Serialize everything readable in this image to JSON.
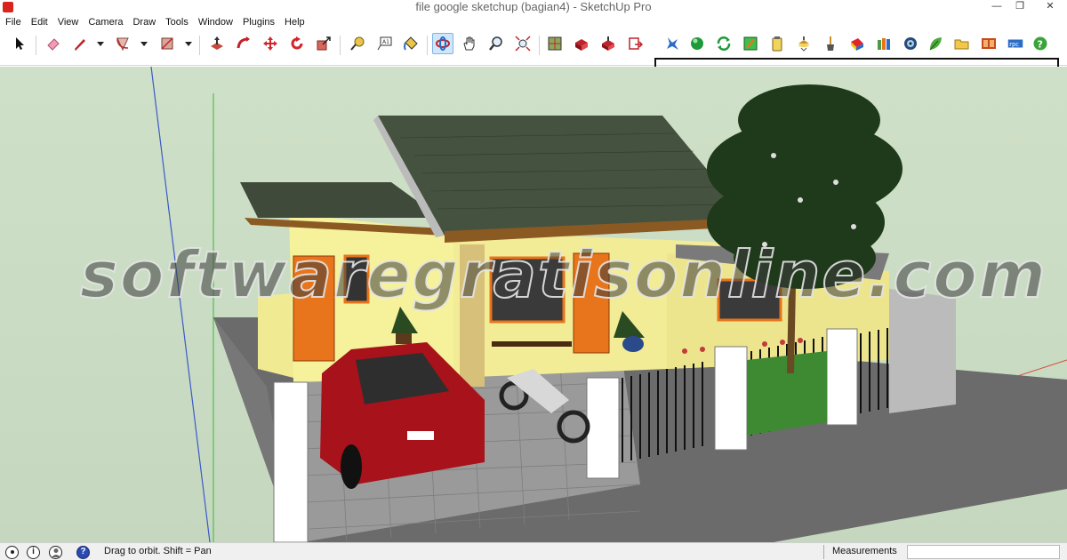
{
  "window": {
    "title": "file google sketchup (bagian4) - SketchUp Pro",
    "minimize_glyph": "—",
    "restore_glyph": "❐",
    "close_glyph": "✕"
  },
  "menu": [
    "File",
    "Edit",
    "View",
    "Camera",
    "Draw",
    "Tools",
    "Window",
    "Plugins",
    "Help"
  ],
  "toolbar": {
    "active_tool": "orbit",
    "main_tools": [
      "select-icon",
      "eraser-icon",
      "pencil-icon",
      "arc-icon",
      "rectangle-icon",
      "push-pull-icon",
      "follow-me-icon",
      "move-icon",
      "rotate-icon",
      "scale-icon",
      "tape-measure-icon",
      "text-icon",
      "paint-bucket-icon",
      "orbit-icon",
      "pan-icon",
      "zoom-icon",
      "zoom-extents-icon",
      "warehouse-icon",
      "get-models-icon",
      "share-model-icon",
      "send-to-layout-icon"
    ],
    "plugin_tools": [
      "plugin-1-icon",
      "sphere-icon",
      "refresh-icon",
      "material-editor-icon",
      "clipboard-icon",
      "light-icon",
      "brush-icon",
      "material-icon",
      "library-icon",
      "render-settings-icon",
      "leaf-icon",
      "folder-icon",
      "animation-icon",
      "rpc-icon",
      "help-icon"
    ],
    "rpc_label": "rpc",
    "help_glyph": "?"
  },
  "viewport": {
    "watermark": "softwaregratisonline.com"
  },
  "status": {
    "info_glyph": "i",
    "hint": "Drag to orbit.  Shift = Pan",
    "help_glyph": "?",
    "measurements_label": "Measurements",
    "measurements_value": ""
  },
  "colors": {
    "sky": "#c9dcc3",
    "wall": "#f6f19b",
    "roof": "#3f4a3a",
    "car": "#a8121a",
    "door": "#e8741c",
    "accent_active": "#cfe6fb"
  }
}
